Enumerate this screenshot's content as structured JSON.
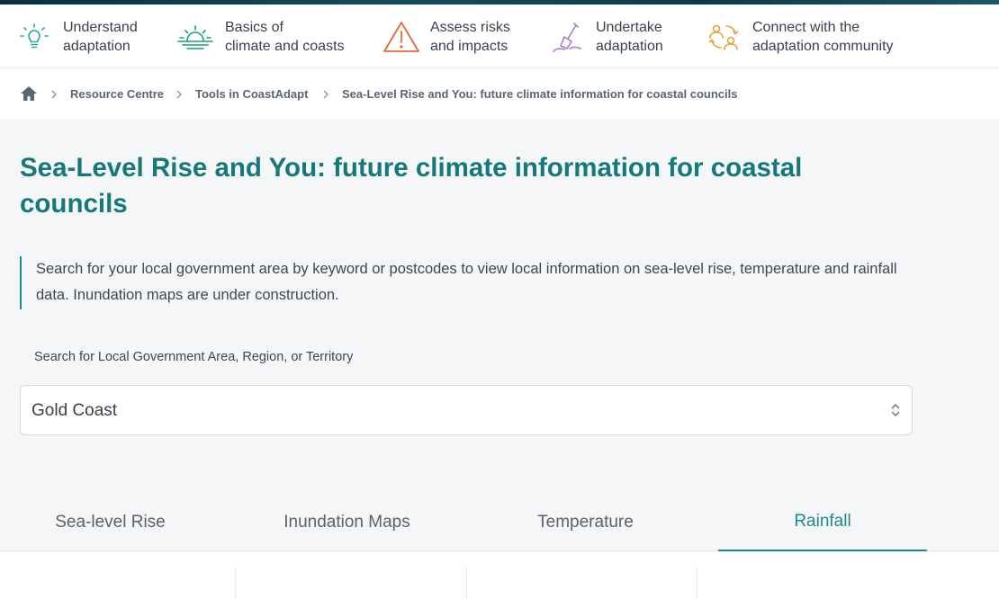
{
  "nav": {
    "items": [
      {
        "line1": "Understand",
        "line2": "adaptation",
        "icon": "lightbulb-icon",
        "color": "#2aa6a6"
      },
      {
        "line1": "Basics of",
        "line2": "climate and coasts",
        "icon": "sun-horizon-icon",
        "color": "#1f9d78"
      },
      {
        "line1": "Assess risks",
        "line2": "and impacts",
        "icon": "warning-icon",
        "color": "#e06a3c"
      },
      {
        "line1": "Undertake",
        "line2": "adaptation",
        "icon": "shovel-icon",
        "color": "#a77cc8"
      },
      {
        "line1": "Connect with the",
        "line2": "adaptation community",
        "icon": "people-cycle-icon",
        "color": "#e4a23a"
      }
    ]
  },
  "breadcrumb": {
    "home_icon": "home-icon",
    "items": [
      "Resource Centre",
      "Tools in CoastAdapt",
      "Sea-Level Rise and You: future climate information for coastal councils"
    ]
  },
  "page": {
    "title": "Sea-Level Rise and You: future climate information for coastal councils",
    "intro": "Search for your local government area by keyword or postcodes to view local information on sea-level rise, temperature and rainfall data. Inundation maps are under construction."
  },
  "search": {
    "label": "Search for Local Government Area, Region, or Territory",
    "value": "Gold Coast"
  },
  "tabs": [
    {
      "label": "Sea-level Rise",
      "active": false
    },
    {
      "label": "Inundation Maps",
      "active": false
    },
    {
      "label": "Temperature",
      "active": false
    },
    {
      "label": "Rainfall",
      "active": true
    }
  ],
  "colors": {
    "accent": "#15787a",
    "tab_active": "#1a8a8a"
  }
}
